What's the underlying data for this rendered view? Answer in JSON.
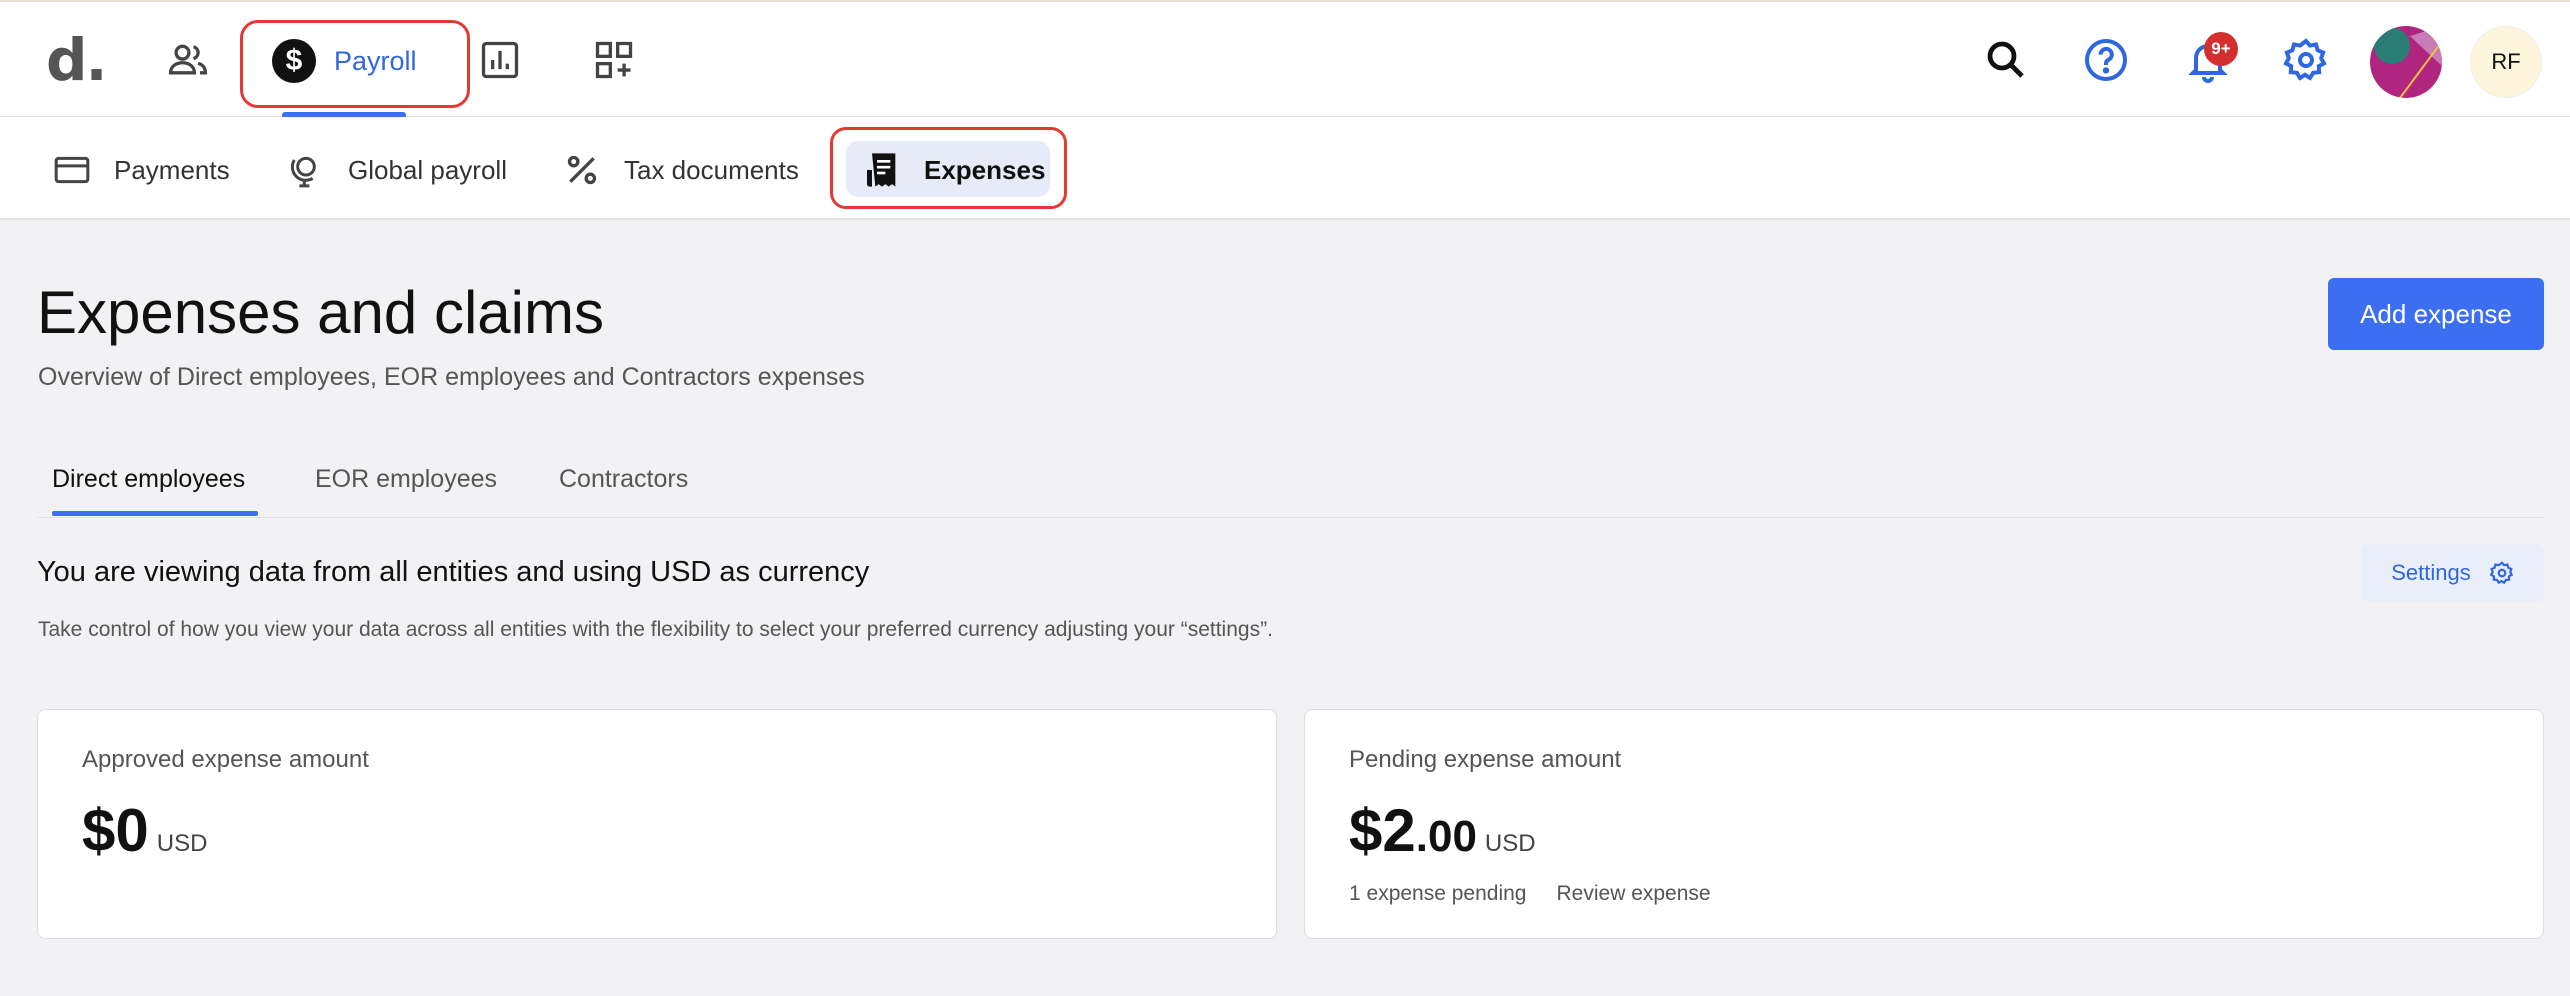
{
  "topnav": {
    "logo": "d.",
    "payroll_label": "Payroll",
    "payroll_symbol": "$",
    "notification_count": "9+",
    "avatar_initials": "RF",
    "icons": [
      "people-icon",
      "dollar-circle-icon",
      "bar-chart-icon",
      "apps-add-icon",
      "search-icon",
      "help-icon",
      "bell-icon",
      "gear-icon"
    ]
  },
  "subnav": {
    "items": [
      {
        "label": "Payments",
        "icon": "credit-card-icon"
      },
      {
        "label": "Global payroll",
        "icon": "globe-icon"
      },
      {
        "label": "Tax documents",
        "icon": "percent-icon"
      },
      {
        "label": "Expenses",
        "icon": "receipt-icon"
      }
    ]
  },
  "page": {
    "title": "Expenses and claims",
    "subtitle": "Overview of Direct employees, EOR employees and Contractors expenses",
    "add_button": "Add expense"
  },
  "tabs": [
    "Direct employees",
    "EOR employees",
    "Contractors"
  ],
  "info": {
    "title": "You are viewing data from all entities and using USD as currency",
    "description": "Take control of how you view your data across all entities with the flexibility to select your preferred currency adjusting your “settings”.",
    "settings_label": "Settings"
  },
  "cards": {
    "approved": {
      "label": "Approved expense amount",
      "amount": "$0",
      "currency": "USD"
    },
    "pending": {
      "label": "Pending expense amount",
      "amount": "$2",
      "cents": ".00",
      "currency": "USD",
      "pending_text": "1 expense pending",
      "review_link": "Review expense"
    }
  },
  "colors": {
    "accent": "#3b6ef0",
    "highlight_outline": "#e53935",
    "badge": "#d32f2f"
  }
}
